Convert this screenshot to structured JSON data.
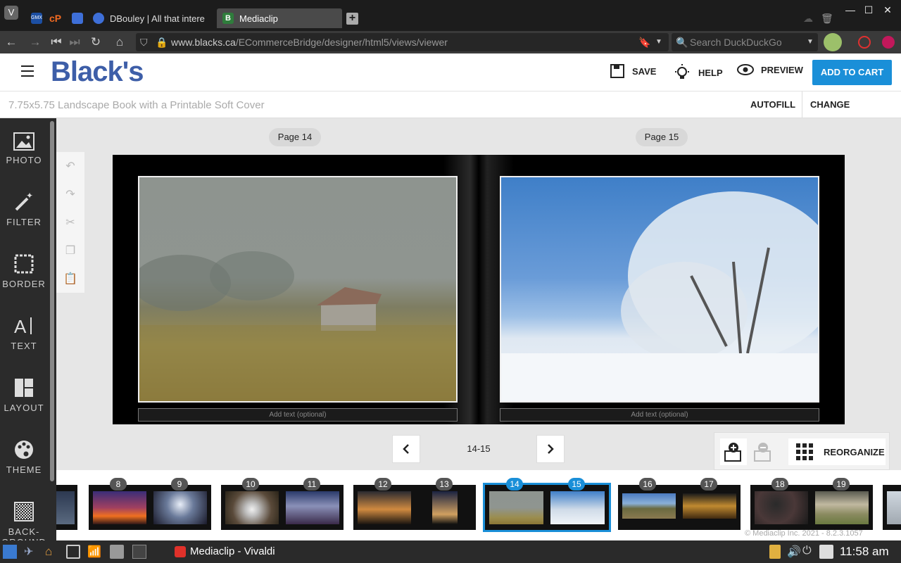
{
  "browser": {
    "tabs": [
      {
        "label": ""
      },
      {
        "label": ""
      },
      {
        "label": ""
      },
      {
        "label": "DBouley | All that intere"
      },
      {
        "label": "Mediaclip"
      }
    ],
    "url_domain": "www.blacks.ca",
    "url_path": "/ECommerceBridge/designer/html5/views/viewer",
    "search_placeholder": "Search DuckDuckGo"
  },
  "header": {
    "logo": "Black's",
    "save": "SAVE",
    "help": "HELP",
    "preview": "PREVIEW",
    "cart": "ADD TO CART"
  },
  "subheader": {
    "product": "7.75x5.75 Landscape Book with a Printable Soft Cover",
    "autofill": "AUTOFILL",
    "change_product": "CHANGE PRODUCT"
  },
  "sidebar": {
    "items": [
      {
        "label": "PHOTO",
        "icon": "photo-icon"
      },
      {
        "label": "FILTER",
        "icon": "magic-wand-icon"
      },
      {
        "label": "BORDER",
        "icon": "border-icon"
      },
      {
        "label": "TEXT",
        "icon": "text-icon"
      },
      {
        "label": "LAYOUT",
        "icon": "layout-icon"
      },
      {
        "label": "THEME",
        "icon": "palette-icon"
      },
      {
        "label": "BACK-GROUND",
        "icon": "background-icon"
      }
    ]
  },
  "spread": {
    "left_page": "Page 14",
    "right_page": "Page 15",
    "left_caption": "Add text (optional)",
    "right_caption": "Add text (optional)"
  },
  "pager": {
    "current": "14-15"
  },
  "page_tools": {
    "reorganize": "REORGANIZE"
  },
  "filmstrip": {
    "pages": [
      {
        "left": "8",
        "right": "9"
      },
      {
        "left": "10",
        "right": "11"
      },
      {
        "left": "12",
        "right": "13"
      },
      {
        "left": "14",
        "right": "15",
        "selected": true
      },
      {
        "left": "16",
        "right": "17"
      },
      {
        "left": "18",
        "right": "19"
      }
    ]
  },
  "copyright": "© Mediaclip Inc. 2021 - 8.2.3.1057",
  "taskbar": {
    "window_title": "Mediaclip - Vivaldi",
    "clock": "11:58 am"
  },
  "colors": {
    "accent": "#1a8fd8",
    "logo": "#3d5ea8",
    "sidebar": "#2b2b2b"
  }
}
